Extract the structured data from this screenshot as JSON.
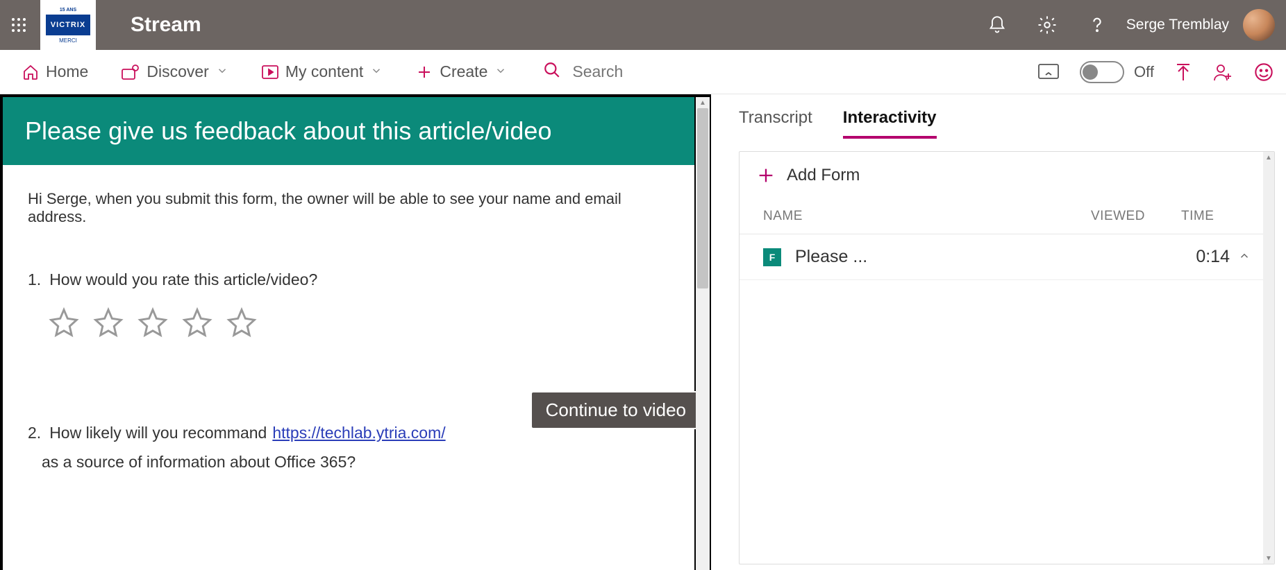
{
  "header": {
    "logo_top": "15 ANS",
    "logo_mid": "VICTRIX",
    "logo_bottom": "MERCI",
    "app_name": "Stream",
    "user_name": "Serge Tremblay"
  },
  "nav": {
    "items": [
      {
        "label": "Home",
        "icon": "home-icon",
        "has_dropdown": false
      },
      {
        "label": "Discover",
        "icon": "discover-icon",
        "has_dropdown": true
      },
      {
        "label": "My content",
        "icon": "mycontent-icon",
        "has_dropdown": true
      },
      {
        "label": "Create",
        "icon": "plus-icon",
        "has_dropdown": true
      }
    ],
    "search_placeholder": "Search",
    "toggle_label": "Off"
  },
  "form": {
    "title": "Please give us feedback about this article/video",
    "privacy_note": "Hi Serge, when you submit this form, the owner will be able to see your name and email address.",
    "q1_number": "1.",
    "q1_text": "How would you rate this article/video?",
    "q2_number": "2.",
    "q2_text_a": "How likely will you recommand",
    "q2_link": "https://techlab.ytria.com/",
    "q2_text_b": "as a source of information about Office 365?",
    "star_count": 5,
    "continue_label": "Continue to video"
  },
  "side": {
    "tabs": [
      "Transcript",
      "Interactivity"
    ],
    "active_tab": 1,
    "add_form_label": "Add Form",
    "columns": {
      "name": "NAME",
      "viewed": "VIEWED",
      "time": "TIME"
    },
    "rows": [
      {
        "name": "Please ...",
        "viewed": "",
        "time": "0:14"
      }
    ]
  }
}
